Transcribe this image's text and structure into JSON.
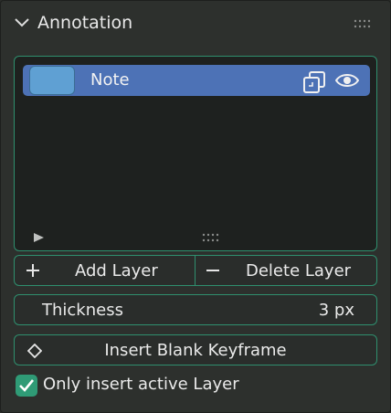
{
  "panel": {
    "title": "Annotation",
    "icons": {
      "collapse": "chevron-down-icon",
      "grip": "drag-grip-icon"
    }
  },
  "layers": {
    "items": [
      {
        "name": "Note",
        "color": "#5fa0d3",
        "selected": true
      }
    ],
    "icons": {
      "duplicate": "duplicate-icon",
      "visibility": "eye-icon",
      "expand": "play-icon",
      "resize": "resize-grip-icon"
    }
  },
  "actions": {
    "add_layer": "Add Layer",
    "delete_layer": "Delete Layer"
  },
  "thickness": {
    "label": "Thickness",
    "value": "3 px"
  },
  "keyframe": {
    "label": "Insert Blank Keyframe"
  },
  "only_active": {
    "label": "Only insert active Layer",
    "checked": true
  },
  "colors": {
    "accent": "#2f9b76",
    "selected_row": "#4d72b6",
    "panel_bg": "#2d302d"
  }
}
